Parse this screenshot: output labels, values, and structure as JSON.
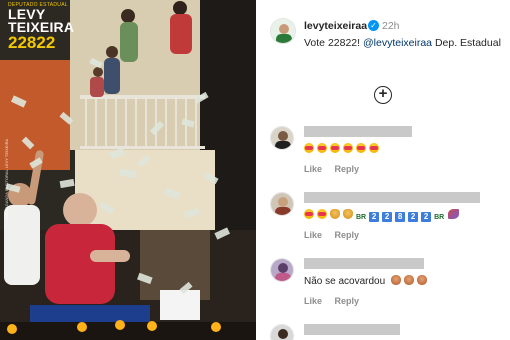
{
  "media": {
    "kicker": "Deputado Estadual",
    "brand_name_line1": "LEVY",
    "brand_name_line2": "TEIXEIRA",
    "brand_number": "22822",
    "vertical_text": "PROPAGANDA ELEITORAL LEVY TEIXEIRA",
    "colors": {
      "brand_yellow": "#f2c800",
      "banner_blue": "#1d3e8c",
      "shirt_red": "#c8263a"
    }
  },
  "post": {
    "author": "levyteixeiraa",
    "verified_icon": "verified-badge-icon",
    "time": "22h",
    "caption_text": "Vote 22822!",
    "caption_mention": "@levyteixeiraa",
    "caption_tail": "Dep. Estadual"
  },
  "add_button": {
    "icon": "plus-circle-icon",
    "symbol": "+"
  },
  "comments": [
    {
      "body_tokens": [
        "heart-face",
        "heart-face",
        "heart-face",
        "heart-face",
        "heart-face",
        "heart-face"
      ],
      "like": "Like",
      "reply": "Reply"
    },
    {
      "body_prefix_tokens": [
        "heart-face",
        "heart-face",
        "clapping-hands",
        "clapping-hands"
      ],
      "body_flag_1": "BR",
      "body_digits": [
        "2",
        "2",
        "8",
        "2",
        "2"
      ],
      "body_flag_2": "BR",
      "body_suffix": "rocket",
      "like": "Like",
      "reply": "Reply"
    },
    {
      "text": "Não se acovardou",
      "emoji_tokens": [
        "flexed-arm",
        "flexed-arm",
        "flexed-arm"
      ],
      "like": "Like",
      "reply": "Reply"
    }
  ],
  "colors": {
    "link": "#00376b",
    "meta_grey": "#8e8e8e",
    "verified_blue": "#0095f6",
    "text": "#262626"
  }
}
